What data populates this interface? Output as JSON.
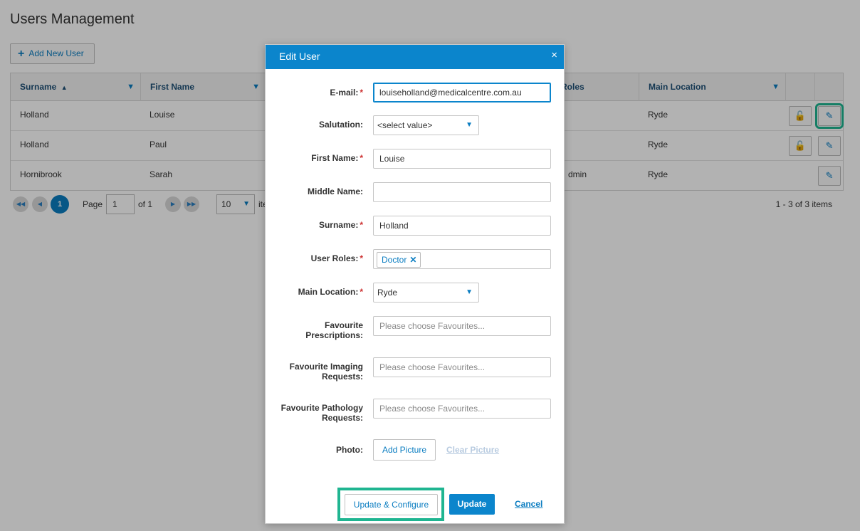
{
  "page": {
    "title": "Users Management"
  },
  "toolbar": {
    "add_label": "Add New User"
  },
  "grid": {
    "columns": [
      "Surname",
      "First Name",
      "Roles",
      "Main Location"
    ],
    "sort_indicator": "▲",
    "rows": [
      {
        "surname": "Holland",
        "first_name": "Louise",
        "roles": "",
        "location": "Ryde"
      },
      {
        "surname": "Holland",
        "first_name": "Paul",
        "roles": "",
        "location": "Ryde"
      },
      {
        "surname": "Hornibrook",
        "first_name": "Sarah",
        "roles": "dmin",
        "location": "Ryde"
      }
    ]
  },
  "pager": {
    "current_page": "1",
    "page_label": "Page",
    "page_value": "1",
    "of_label": "of 1",
    "page_size": "10",
    "items_label": "ite",
    "summary": "1 - 3 of 3 items"
  },
  "modal": {
    "title": "Edit User",
    "close": "×",
    "email_label": "E-mail:",
    "email_value": "louiseholland@medicalcentre.com.au",
    "salutation_label": "Salutation:",
    "salutation_value": "<select value>",
    "first_name_label": "First Name:",
    "first_name_value": "Louise",
    "middle_name_label": "Middle Name:",
    "middle_name_value": "",
    "surname_label": "Surname:",
    "surname_value": "Holland",
    "roles_label": "User Roles:",
    "roles_tag": "Doctor",
    "location_label": "Main Location:",
    "location_value": "Ryde",
    "fav_presc_label_1": "Favourite",
    "fav_presc_label_2": "Prescriptions:",
    "fav_imaging_label_1": "Favourite Imaging",
    "fav_imaging_label_2": "Requests:",
    "fav_path_label_1": "Favourite Pathology",
    "fav_path_label_2": "Requests:",
    "fav_placeholder": "Please choose Favourites...",
    "photo_label": "Photo:",
    "add_picture": "Add Picture",
    "clear_picture": "Clear Picture",
    "update_configure": "Update & Configure",
    "update": "Update",
    "cancel": "Cancel",
    "required_mark": "*"
  },
  "colors": {
    "accent": "#0b85cc",
    "highlight": "#1fb591",
    "required": "#cc2f2f"
  }
}
